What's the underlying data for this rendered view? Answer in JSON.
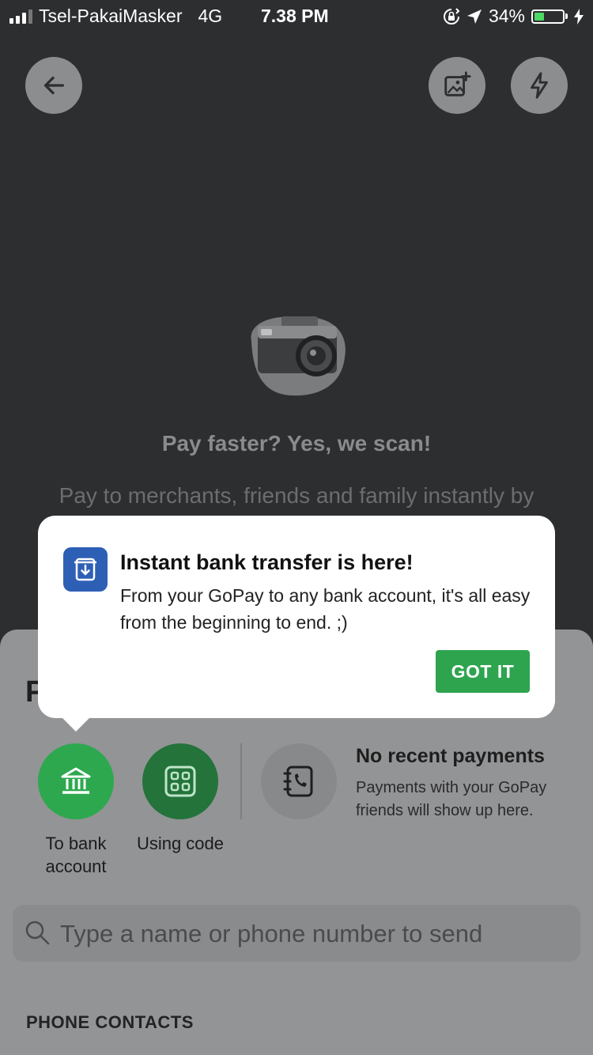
{
  "status_bar": {
    "carrier": "Tsel-PakaiMasker",
    "network": "4G",
    "time": "7.38 PM",
    "battery": "34%",
    "battery_level": 0.34,
    "battery_color": "#4cd964"
  },
  "toolbar": {
    "back_icon": "arrow-left-icon",
    "gallery_icon": "image-add-icon",
    "flash_icon": "lightning-icon"
  },
  "scan": {
    "title": "Pay faster? Yes, we scan!",
    "description": "Pay to merchants, friends and family instantly by scanning their QR code."
  },
  "tooltip": {
    "title": "Instant bank transfer is here!",
    "body": "From your GoPay to any bank account, it's all easy from the beginning to end. ;)",
    "button": "GOT IT",
    "icon": "bank-transfer-icon",
    "accent_color": "#2ea44f",
    "icon_bg": "#2d5fb5"
  },
  "sheet": {
    "heading": "P",
    "options": [
      {
        "label": "To bank account",
        "icon": "bank-icon",
        "color": "#2ea84f"
      },
      {
        "label": "Using code",
        "icon": "qr-code-icon",
        "color": "#23733a"
      }
    ],
    "recent": {
      "title": "No recent payments",
      "description": "Payments with your GoPay friends will show up here.",
      "icon": "phone-book-icon"
    },
    "search": {
      "placeholder": "Type a name or phone number to send"
    },
    "contacts_label": "PHONE CONTACTS"
  }
}
